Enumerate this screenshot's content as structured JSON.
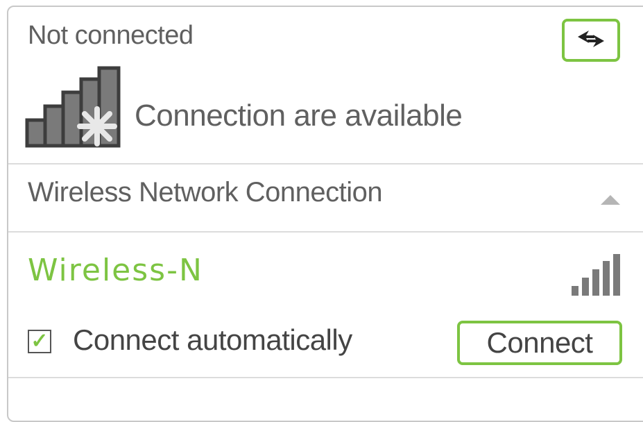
{
  "header": {
    "status": "Not connected",
    "refresh_icon": "refresh-arrows-icon"
  },
  "availability": {
    "icon": "signal-star-icon",
    "text": "Connection are available"
  },
  "section": {
    "title": "Wireless Network Connection",
    "toggle_icon": "triangle-up-icon"
  },
  "network": {
    "name": "Wireless-N",
    "signal_icon": "signal-bars-icon",
    "auto_connect_label": "Connect automatically",
    "auto_connect_checked": true,
    "connect_label": "Connect"
  },
  "colors": {
    "accent": "#7dc442",
    "text": "#606060",
    "divider": "#dcdcdc"
  }
}
